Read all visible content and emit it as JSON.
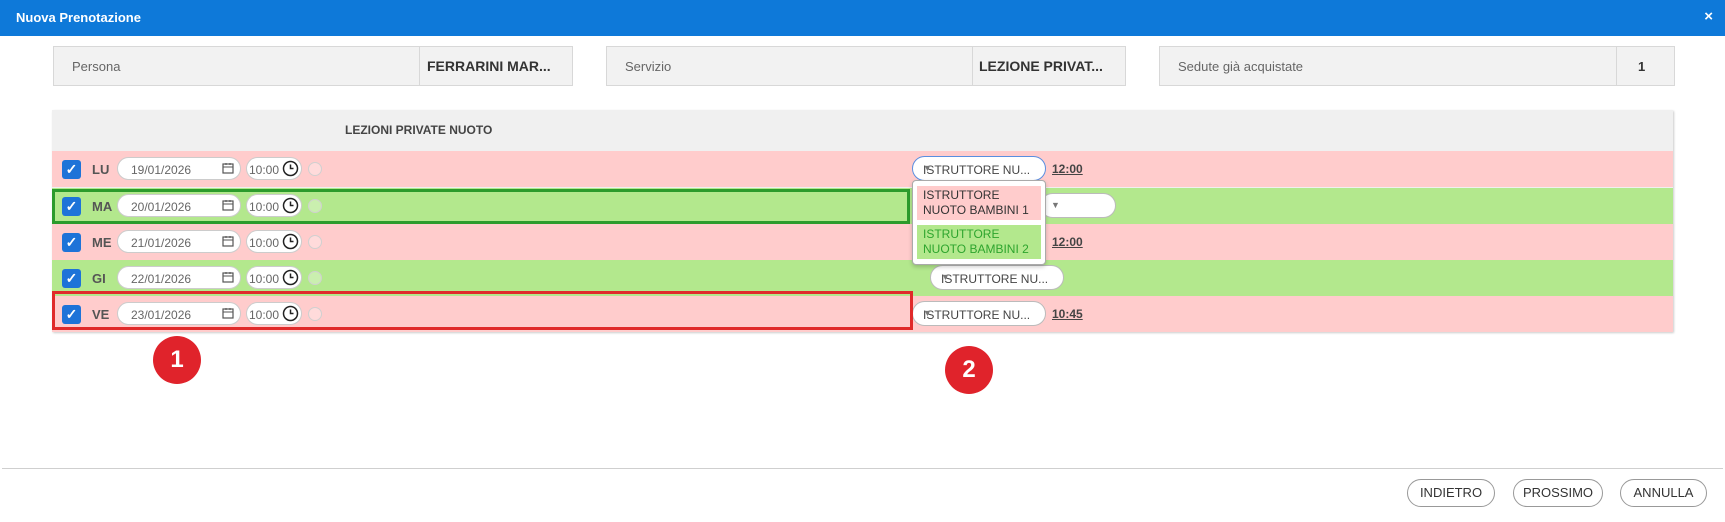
{
  "window": {
    "title": "Nuova Prenotazione",
    "close_symbol": "×"
  },
  "info": {
    "persona_label": "Persona",
    "persona_value": "FERRARINI MAR...",
    "servizio_label": "Servizio",
    "servizio_value": "LEZIONE PRIVAT...",
    "sedute_label": "Sedute già acquistate",
    "sedute_value": "1"
  },
  "table": {
    "header": "LEZIONI PRIVATE NUOTO",
    "rows": [
      {
        "day": "LU",
        "date": "19/01/2026",
        "time": "10:00",
        "instructor": "ISTRUTTORE NU...",
        "slot_time": "12:00",
        "status": "red"
      },
      {
        "day": "MA",
        "date": "20/01/2026",
        "time": "10:00",
        "instructor": "",
        "slot_time": "",
        "status": "green"
      },
      {
        "day": "ME",
        "date": "21/01/2026",
        "time": "10:00",
        "instructor": "",
        "slot_time": "12:00",
        "status": "red"
      },
      {
        "day": "GI",
        "date": "22/01/2026",
        "time": "10:00",
        "instructor": "ISTRUTTORE NU...",
        "slot_time": "",
        "status": "green"
      },
      {
        "day": "VE",
        "date": "23/01/2026",
        "time": "10:00",
        "instructor": "ISTRUTTORE NU...",
        "slot_time": "10:45",
        "status": "red"
      }
    ]
  },
  "dropdown": {
    "options": [
      {
        "label": "ISTRUTTORE NUOTO BAMBINI 1",
        "status": "red"
      },
      {
        "label": "ISTRUTTORE NUOTO BAMBINI 2",
        "status": "green"
      }
    ]
  },
  "annotations": {
    "badge1": "1",
    "badge2": "2"
  },
  "footer": {
    "back_label": "INDIETRO",
    "next_label": "PROSSIMO",
    "cancel_label": "ANNULLA"
  },
  "colors": {
    "titlebar": "#0e79d9",
    "row_unavailable": "#ffcccc",
    "row_available": "#b3e88d",
    "checkbox": "#1e73d8",
    "highlight_green": "#2c9b2c",
    "highlight_red": "#e02a2a",
    "badge": "#e0232b"
  },
  "icons": [
    "close-icon",
    "checkbox-icon",
    "calendar-icon",
    "clock-icon",
    "chevron-down-icon"
  ]
}
